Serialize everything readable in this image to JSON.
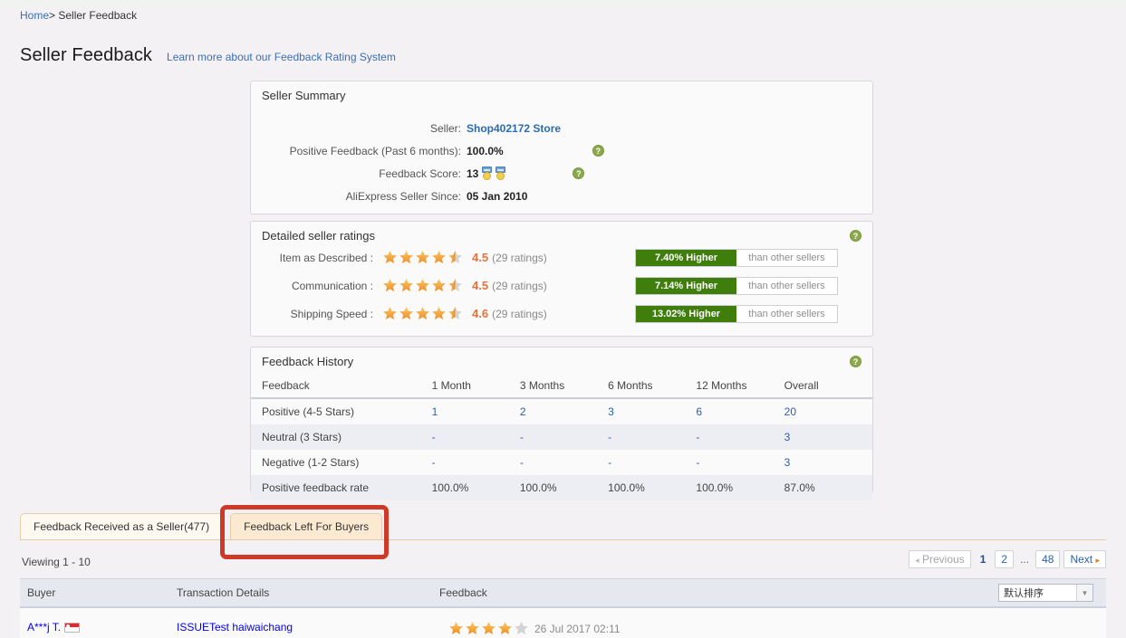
{
  "breadcrumb": {
    "home": "Home",
    "separator": "> ",
    "current": "Seller Feedback"
  },
  "header": {
    "title": "Seller Feedback",
    "learn_more": "Learn more about our Feedback Rating System"
  },
  "seller_summary": {
    "panel_title": "Seller Summary",
    "rows": [
      {
        "label": "Seller:",
        "value": "Shop402172 Store",
        "is_link": true,
        "help": false
      },
      {
        "label": "Positive Feedback (Past 6 months):",
        "value": "100.0%",
        "is_link": false,
        "help": true
      },
      {
        "label": "Feedback Score:",
        "value": "13",
        "is_link": false,
        "help": true,
        "medals": 2
      },
      {
        "label": "AliExpress Seller Since:",
        "value": "05 Jan 2010",
        "is_link": false,
        "help": false
      }
    ]
  },
  "detailed_ratings": {
    "panel_title": "Detailed seller ratings",
    "help_icon": "help-icon",
    "compare_suffix": "than other sellers",
    "rows": [
      {
        "label": "Item as Described :",
        "stars": 4.5,
        "score": "4.5",
        "count": "(29 ratings)",
        "delta": "7.40% Higher"
      },
      {
        "label": "Communication :",
        "stars": 4.5,
        "score": "4.5",
        "count": "(29 ratings)",
        "delta": "7.14% Higher"
      },
      {
        "label": "Shipping Speed :",
        "stars": 4.5,
        "score": "4.6",
        "count": "(29 ratings)",
        "delta": "13.02% Higher"
      }
    ]
  },
  "feedback_history": {
    "panel_title": "Feedback History",
    "columns": [
      "Feedback",
      "1 Month",
      "3 Months",
      "6 Months",
      "12 Months",
      "Overall"
    ],
    "rows": [
      {
        "label": "Positive (4-5 Stars)",
        "values": [
          "1",
          "2",
          "3",
          "6",
          "20"
        ],
        "link": true
      },
      {
        "label": "Neutral (3 Stars)",
        "values": [
          "-",
          "-",
          "-",
          "-",
          "3"
        ],
        "link": true
      },
      {
        "label": "Negative (1-2 Stars)",
        "values": [
          "-",
          "-",
          "-",
          "-",
          "3"
        ],
        "link": true
      },
      {
        "label": "Positive feedback rate",
        "values": [
          "100.0%",
          "100.0%",
          "100.0%",
          "100.0%",
          "87.0%"
        ],
        "link": false
      }
    ]
  },
  "tabs": [
    {
      "label": "Feedback Received as a Seller(477)",
      "active": true
    },
    {
      "label": "Feedback Left For Buyers",
      "active": false
    }
  ],
  "list": {
    "viewing": "Viewing 1 - 10",
    "columns": {
      "buyer": "Buyer",
      "transaction": "Transaction Details",
      "feedback": "Feedback"
    },
    "sort": {
      "value": "默认排序",
      "arrow": "chevron-down-icon"
    },
    "rows": [
      {
        "buyer": "A***j T.",
        "flag": "singapore-flag-icon",
        "transaction": "ISSUETest haiwaichang",
        "stars": 4,
        "date": "26 Jul 2017 02:11"
      }
    ]
  },
  "pagination": {
    "previous": "Previous",
    "next": "Next",
    "pages": [
      "1",
      "2",
      "...",
      "48"
    ],
    "current": "1"
  },
  "colors": {
    "link": "#2b6cb0",
    "accent_orange": "#e8703a",
    "badge_green": "#3f7d0d",
    "help_green": "#8ba94b",
    "highlight_red": "#cf3a28",
    "page_bg": "#f3f1f4",
    "tab_active": "#fdf8f0",
    "tab_inactive": "#fbe9d2"
  }
}
